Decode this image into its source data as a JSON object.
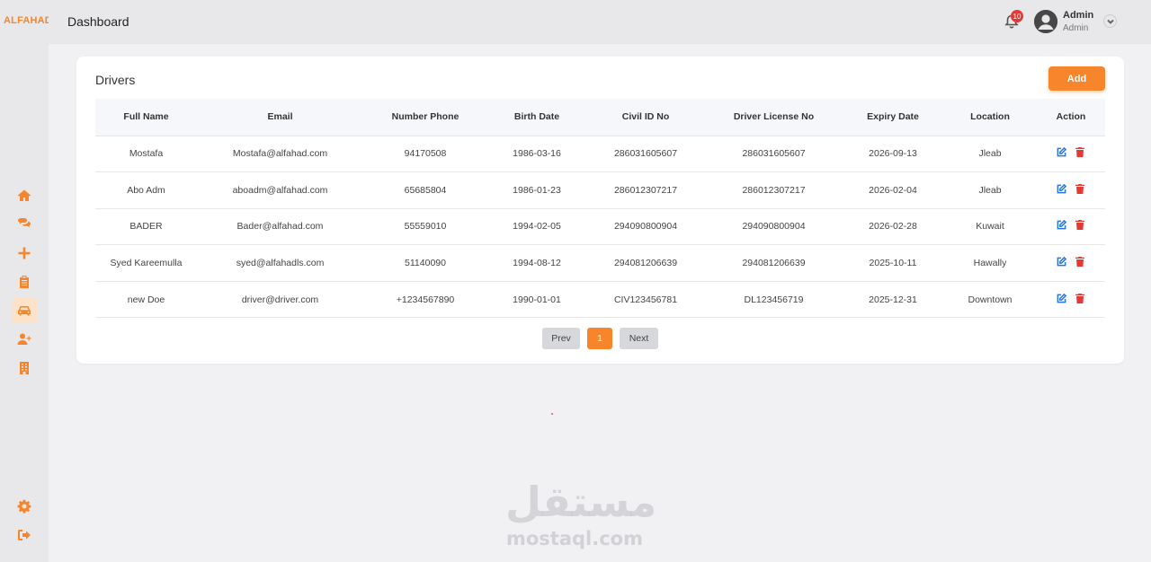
{
  "brand": "ALFAHAD",
  "header": {
    "title": "Dashboard",
    "notifications_count": "10",
    "user_name": "Admin",
    "user_role": "Admin"
  },
  "sidebar": {
    "items": [
      {
        "name": "home-icon",
        "active": false
      },
      {
        "name": "chat-icon",
        "active": false
      },
      {
        "name": "plus-icon",
        "active": false
      },
      {
        "name": "clipboard-icon",
        "active": false
      },
      {
        "name": "car-icon",
        "active": true
      },
      {
        "name": "user-plus-icon",
        "active": false
      },
      {
        "name": "building-icon",
        "active": false
      },
      {
        "name": "gear-icon",
        "active": false
      },
      {
        "name": "sign-out-icon",
        "active": false
      }
    ]
  },
  "main": {
    "card_title": "Drivers",
    "add_label": "Add",
    "columns": [
      "Full Name",
      "Email",
      "Number Phone",
      "Birth Date",
      "Civil ID No",
      "Driver License No",
      "Expiry Date",
      "Location",
      "Action"
    ],
    "rows": [
      [
        "Mostafa",
        "Mostafa@alfahad.com",
        "94170508",
        "1986-03-16",
        "286031605607",
        "286031605607",
        "2026-09-13",
        "Jleab"
      ],
      [
        "Abo Adm",
        "aboadm@alfahad.com",
        "65685804",
        "1986-01-23",
        "286012307217",
        "286012307217",
        "2026-02-04",
        "Jleab"
      ],
      [
        "BADER",
        "Bader@alfahad.com",
        "55559010",
        "1994-02-05",
        "294090800904",
        "294090800904",
        "2026-02-28",
        "Kuwait"
      ],
      [
        "Syed Kareemulla",
        "syed@alfahadls.com",
        "51140090",
        "1994-08-12",
        "294081206639",
        "294081206639",
        "2025-10-11",
        "Hawally"
      ],
      [
        "new Doe",
        "driver@driver.com",
        "+1234567890",
        "1990-01-01",
        "CIV123456781",
        "DL123456719",
        "2025-12-31",
        "Downtown"
      ]
    ],
    "pagination": {
      "prev": "Prev",
      "current": "1",
      "next": "Next"
    }
  },
  "watermark": {
    "arabic": "مستقل",
    "latin": "mostaql.com"
  },
  "colors": {
    "accent": "#f7852b",
    "edit": "#2b78e4",
    "delete": "#e53935"
  }
}
